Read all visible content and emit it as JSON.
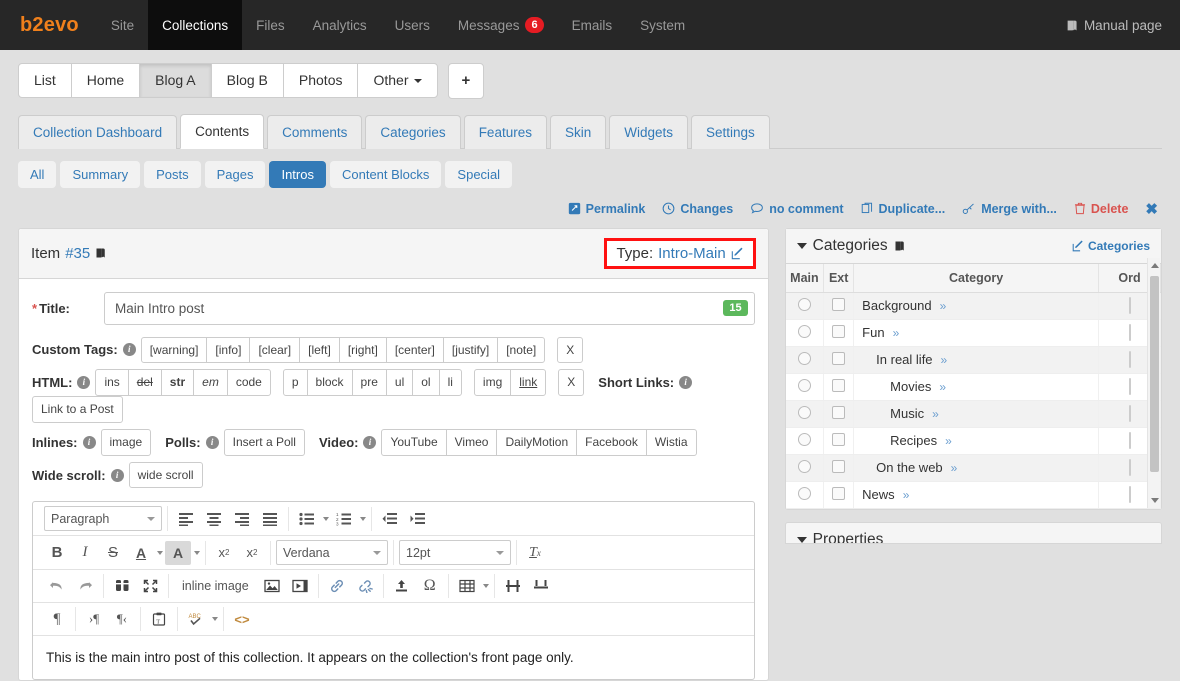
{
  "topnav": {
    "brand": "b2evo",
    "items": [
      {
        "label": "Site",
        "active": false
      },
      {
        "label": "Collections",
        "active": true
      },
      {
        "label": "Files",
        "active": false
      },
      {
        "label": "Analytics",
        "active": false
      },
      {
        "label": "Users",
        "active": false
      },
      {
        "label": "Messages",
        "active": false,
        "badge": "6"
      },
      {
        "label": "Emails",
        "active": false
      },
      {
        "label": "System",
        "active": false
      }
    ],
    "manual_label": "Manual page",
    "manual_icon": "book-icon"
  },
  "collection_tabs": {
    "items": [
      {
        "label": "List",
        "active": false
      },
      {
        "label": "Home",
        "active": false
      },
      {
        "label": "Blog A",
        "active": true
      },
      {
        "label": "Blog B",
        "active": false
      },
      {
        "label": "Photos",
        "active": false
      },
      {
        "label": "Other",
        "active": false,
        "caret": true
      }
    ],
    "add_label": "+"
  },
  "section_tabs": [
    {
      "label": "Collection Dashboard",
      "active": false
    },
    {
      "label": "Contents",
      "active": true
    },
    {
      "label": "Comments",
      "active": false
    },
    {
      "label": "Categories",
      "active": false
    },
    {
      "label": "Features",
      "active": false
    },
    {
      "label": "Skin",
      "active": false
    },
    {
      "label": "Widgets",
      "active": false
    },
    {
      "label": "Settings",
      "active": false
    }
  ],
  "filters": [
    {
      "label": "All",
      "active": false
    },
    {
      "label": "Summary",
      "active": false
    },
    {
      "label": "Posts",
      "active": false
    },
    {
      "label": "Pages",
      "active": false
    },
    {
      "label": "Intros",
      "active": true
    },
    {
      "label": "Content Blocks",
      "active": false
    },
    {
      "label": "Special",
      "active": false
    }
  ],
  "actions": [
    {
      "label": "Permalink",
      "icon": "permalink-icon"
    },
    {
      "label": "Changes",
      "icon": "clock-icon"
    },
    {
      "label": "no comment",
      "icon": "comment-icon"
    },
    {
      "label": "Duplicate...",
      "icon": "duplicate-icon"
    },
    {
      "label": "Merge with...",
      "icon": "merge-icon"
    },
    {
      "label": "Delete",
      "icon": "trash-icon"
    },
    {
      "label": "✖",
      "icon": "close-icon"
    }
  ],
  "item": {
    "label": "Item",
    "number": "#35",
    "manual_icon": "book-icon",
    "type_label": "Type:",
    "type_value": "Intro-Main",
    "type_edit_icon": "edit-icon",
    "highlight_color": "#ff1111"
  },
  "title": {
    "label": "Title:",
    "required_mark": "*",
    "value": "Main Intro post",
    "placeholder": "",
    "char_count": "15",
    "count_color": "#5cb85c"
  },
  "toolbars": {
    "custom_tags": {
      "label": "Custom Tags:",
      "buttons": [
        "[warning]",
        "[info]",
        "[clear]",
        "[left]",
        "[right]",
        "[center]",
        "[justify]",
        "[note]"
      ],
      "clear": "X"
    },
    "html": {
      "label": "HTML:",
      "group1": [
        "ins",
        "del",
        "str",
        "em",
        "code"
      ],
      "group2": [
        "p",
        "block",
        "pre",
        "ul",
        "ol",
        "li"
      ],
      "group3": [
        "img",
        "link"
      ],
      "clear": "X"
    },
    "short_links": {
      "label": "Short Links:",
      "buttons": [
        "Link to a Post"
      ]
    },
    "inlines": {
      "label": "Inlines:",
      "buttons": [
        "image"
      ]
    },
    "polls": {
      "label": "Polls:",
      "buttons": [
        "Insert a Poll"
      ]
    },
    "video": {
      "label": "Video:",
      "buttons": [
        "YouTube",
        "Vimeo",
        "DailyMotion",
        "Facebook",
        "Wistia"
      ]
    },
    "wide_scroll": {
      "label": "Wide scroll:",
      "buttons": [
        "wide scroll"
      ]
    }
  },
  "editor": {
    "paragraph_select": "Paragraph",
    "font_select": "Verdana",
    "size_select": "12pt",
    "inline_image_label": "inline image",
    "body_text": "This is the main intro post of this collection. It appears on the collection's front page only.",
    "row1_icons": [
      "align-left-icon",
      "align-center-icon",
      "align-right-icon",
      "align-justify-icon",
      "bullet-list-icon",
      "numbered-list-icon",
      "outdent-icon",
      "indent-icon"
    ],
    "row2_icons": [
      "bold-icon",
      "italic-icon",
      "strikethrough-icon",
      "text-color-icon",
      "highlight-color-icon",
      "subscript-icon",
      "superscript-icon",
      "clear-formatting-icon"
    ],
    "row3_icons": [
      "undo-icon",
      "redo-icon",
      "find-replace-icon",
      "fullscreen-icon",
      "image-icon",
      "media-icon",
      "link-icon",
      "unlink-icon",
      "upload-icon",
      "special-char-icon",
      "table-icon",
      "page-break-icon",
      "horizontal-rule-icon"
    ],
    "row4_icons": [
      "paragraph-icon",
      "ltr-icon",
      "rtl-icon",
      "paste-text-icon",
      "spellcheck-icon",
      "source-code-icon"
    ]
  },
  "categories": {
    "title": "Categories",
    "book_icon": "book-icon",
    "edit_label": "Categories",
    "edit_icon": "edit-icon",
    "columns": [
      "Main",
      "Ext",
      "Category",
      "Ord"
    ],
    "rows": [
      {
        "name": "Background",
        "indent": 0,
        "ord": "",
        "main_selected": false,
        "ext_checked": false
      },
      {
        "name": "Fun",
        "indent": 0,
        "ord": "",
        "main_selected": false,
        "ext_checked": false
      },
      {
        "name": "In real life",
        "indent": 1,
        "ord": "",
        "main_selected": false,
        "ext_checked": false
      },
      {
        "name": "Movies",
        "indent": 2,
        "ord": "",
        "main_selected": false,
        "ext_checked": false
      },
      {
        "name": "Music",
        "indent": 2,
        "ord": "",
        "main_selected": false,
        "ext_checked": false
      },
      {
        "name": "Recipes",
        "indent": 2,
        "ord": "",
        "main_selected": false,
        "ext_checked": false
      },
      {
        "name": "On the web",
        "indent": 1,
        "ord": "",
        "main_selected": false,
        "ext_checked": false
      },
      {
        "name": "News",
        "indent": 0,
        "ord": "",
        "main_selected": false,
        "ext_checked": false
      }
    ],
    "link_chevron": "»"
  },
  "properties": {
    "title": "Properties"
  }
}
